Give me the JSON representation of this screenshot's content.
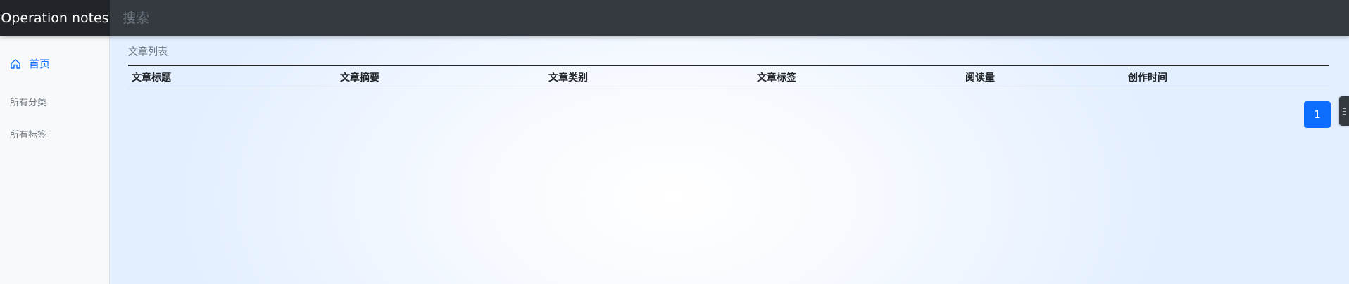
{
  "header": {
    "brand": "Operation notes",
    "search_placeholder": "搜索"
  },
  "sidebar": {
    "items": [
      {
        "label": "首页",
        "icon": "home-icon",
        "active": true
      },
      {
        "label": "所有分类"
      },
      {
        "label": "所有标签"
      }
    ]
  },
  "main": {
    "section_title": "文章列表",
    "table": {
      "columns": [
        "文章标题",
        "文章摘要",
        "文章类别",
        "文章标签",
        "阅读量",
        "创作时间"
      ],
      "rows": []
    },
    "pagination": {
      "current_page": "1"
    }
  },
  "colors": {
    "topbar": "#343a40",
    "brand_bg": "#212529",
    "accent": "#0d6efd",
    "sidebar_bg": "#f8f9fa"
  }
}
